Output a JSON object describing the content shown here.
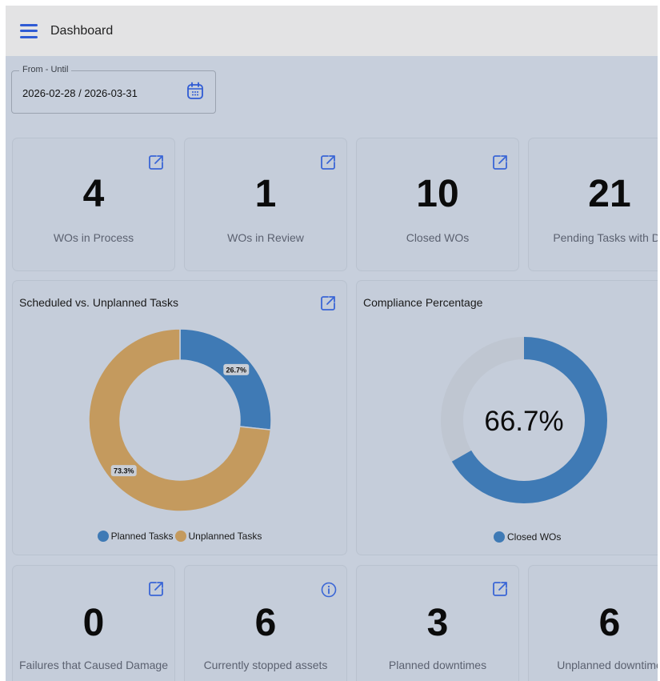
{
  "header": {
    "title": "Dashboard"
  },
  "filter": {
    "label": "From - Until",
    "value": "2026-02-28 / 2026-03-31"
  },
  "stats_top": [
    {
      "value": "4",
      "label": "WOs in Process"
    },
    {
      "value": "1",
      "label": "WOs in Review"
    },
    {
      "value": "10",
      "label": "Closed WOs"
    },
    {
      "value": "21",
      "label": "Pending Tasks with De"
    }
  ],
  "stats_bottom": [
    {
      "value": "0",
      "label": "Failures that Caused Damage"
    },
    {
      "value": "6",
      "label": "Currently stopped assets"
    },
    {
      "value": "3",
      "label": "Planned downtimes"
    },
    {
      "value": "6",
      "label": "Unplanned downtime"
    }
  ],
  "colors": {
    "planned": "#3f7ab5",
    "unplanned": "#c49a5e",
    "remaining": "#bfc6d1",
    "accent": "#2f5bd4"
  },
  "chart_data": [
    {
      "type": "pie",
      "title": "Scheduled vs. Unplanned Tasks",
      "categories": [
        "Planned Tasks",
        "Unplanned Tasks"
      ],
      "values": [
        26.7,
        73.3
      ],
      "data_labels": [
        "26.7%",
        "73.3%"
      ],
      "legend": "bottom"
    },
    {
      "type": "pie",
      "title": "Compliance Percentage",
      "categories": [
        "Closed WOs"
      ],
      "values": [
        66.7
      ],
      "center_label": "66.7%",
      "legend": "bottom"
    }
  ]
}
